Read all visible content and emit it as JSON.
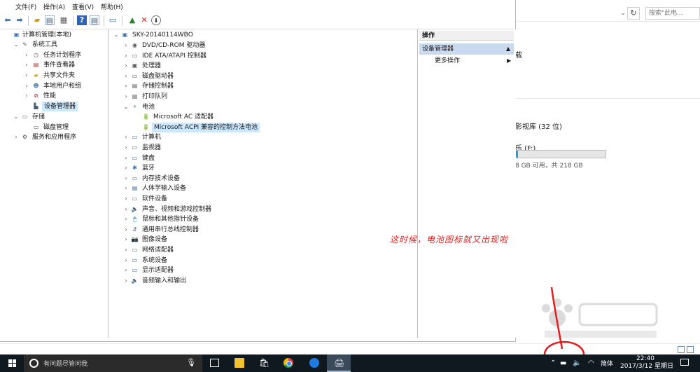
{
  "menubar": {
    "items": [
      "文件(F)",
      "操作(A)",
      "查看(V)",
      "帮助(H)"
    ]
  },
  "toolbar": {
    "buttons": [
      "back-arrow-icon",
      "forward-arrow-icon",
      "folder-up-icon",
      "show-tree-icon",
      "properties-icon",
      "help-icon",
      "view-icon",
      "monitor-icon",
      "update-driver-icon",
      "uninstall-x-icon",
      "download-icon"
    ],
    "uninstall_color": "#d81e1e"
  },
  "left_tree": {
    "root": "计算机管理(本地)",
    "system_tools": "系统工具",
    "task_scheduler": "任务计划程序",
    "event_viewer": "事件查看器",
    "shared_folders": "共享文件夹",
    "local_users": "本地用户和组",
    "performance": "性能",
    "device_manager": "设备管理器",
    "storage": "存储",
    "disk_management": "磁盘管理",
    "services_apps": "服务和应用程序"
  },
  "device_tree": {
    "root": "SKY-20140114WBO",
    "categories": [
      "DVD/CD-ROM 驱动器",
      "IDE ATA/ATAPI 控制器",
      "处理器",
      "磁盘驱动器",
      "存储控制器",
      "打印队列",
      "电池"
    ],
    "battery_children": [
      "Microsoft AC 适配器",
      "Microsoft ACPI 兼容的控制方法电池"
    ],
    "more_categories": [
      "计算机",
      "监视器",
      "键盘",
      "蓝牙",
      "内存技术设备",
      "人体学输入设备",
      "软件设备",
      "声音、视频和游戏控制器",
      "鼠标和其他指针设备",
      "通用串行总线控制器",
      "图像设备",
      "网络适配器",
      "系统设备",
      "显示适配器",
      "音频输入和输出"
    ]
  },
  "actions": {
    "header": "操作",
    "section": "设备管理器",
    "more": "更多操作"
  },
  "annotation": "这时候，电池图标就又出现啦",
  "background_window": {
    "search_placeholder": "搜索\"此电...",
    "text1": "载",
    "text2": "影视库 (32 位)",
    "text3": "乐 (F:)",
    "text4": "8 GB 可用，共 218 GB",
    "drive_used_fraction": 0.02
  },
  "taskbar": {
    "search_placeholder": "有问题尽管问我",
    "apps": [
      "task-view-icon",
      "file-explorer-icon",
      "store-icon",
      "chrome-icon",
      "sogou-browser-icon",
      "device-manager-app-icon"
    ],
    "ime": "简体",
    "time": "22:40",
    "date": "2017/3/12 星期日"
  },
  "colors": {
    "annotation": "#e11d1d",
    "selection": "#cce8ff",
    "taskbar": "#101820"
  }
}
